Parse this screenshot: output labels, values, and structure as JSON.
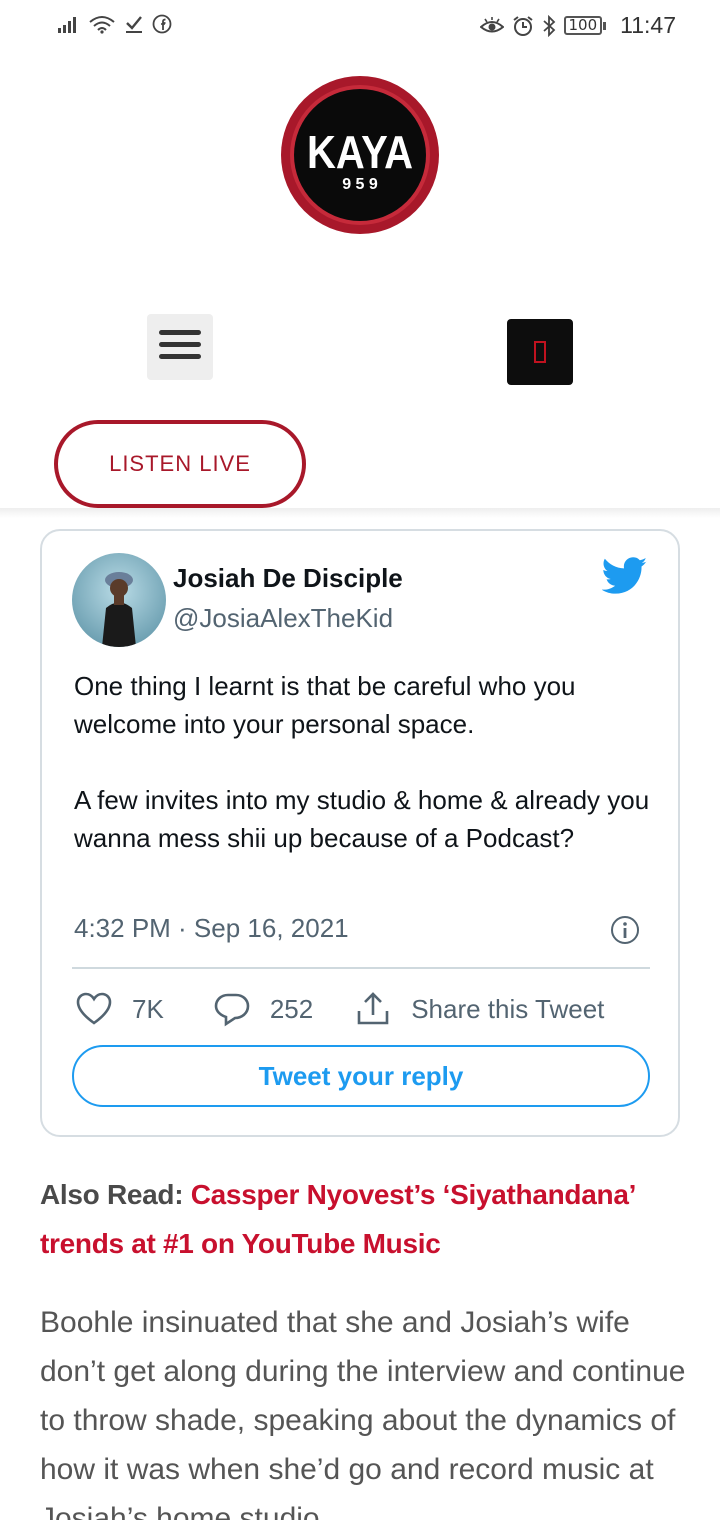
{
  "status_bar": {
    "battery": "100",
    "time": "11:47"
  },
  "header": {
    "logo_text": "KAYA",
    "logo_subtext": "9 5 9",
    "listen_live_label": "LISTEN LIVE"
  },
  "tweet": {
    "author_name": "Josiah De Disciple",
    "author_handle": "@JosiaAlexTheKid",
    "text": "One thing I learnt is that be careful who you welcome into your personal space.\n\nA few invites into my studio & home & already you wanna mess shii up because of a Podcast?",
    "timestamp": "4:32 PM · Sep 16, 2021",
    "likes": "7K",
    "replies": "252",
    "share_label": "Share this Tweet",
    "reply_button_label": "Tweet your reply"
  },
  "article": {
    "also_read_prefix": "Also Read: ",
    "also_read_link": "Cassper Nyovest’s ‘Siyathandana’ trends at #1 on YouTube Music",
    "body_text": "Boohle insinuated that she and Josiah’s wife don’t get along during the interview and continue to throw shade, speaking about the dynamics of how it was when she’d go and record music at Josiah’s home studio."
  },
  "colors": {
    "brand_red": "#a8182a",
    "link_red": "#c8102e",
    "twitter_blue": "#1d9bf0"
  }
}
